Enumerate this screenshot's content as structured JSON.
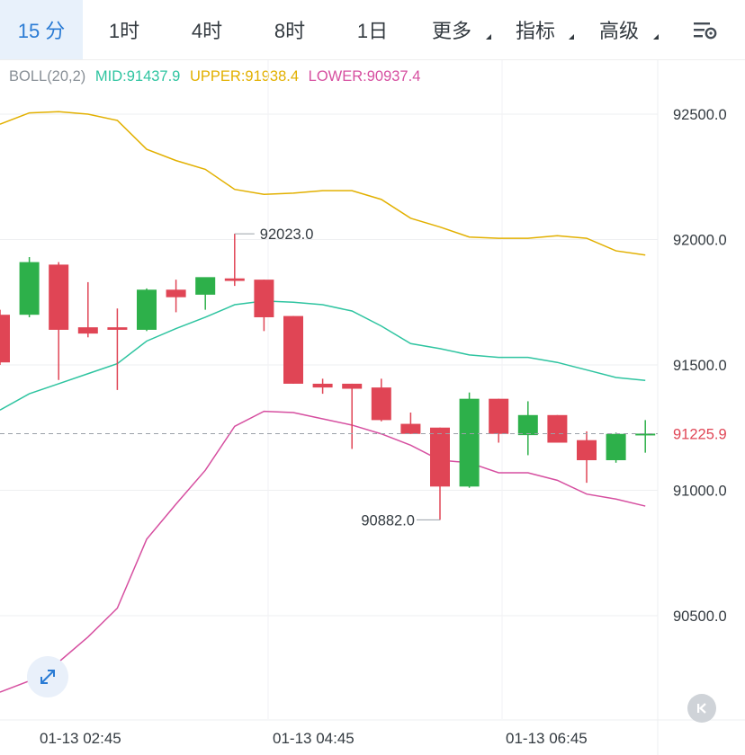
{
  "tabs": [
    {
      "label": "15 分",
      "active": true
    },
    {
      "label": "1时"
    },
    {
      "label": "4时"
    },
    {
      "label": "8时"
    },
    {
      "label": "1日"
    },
    {
      "label": "更多",
      "menu": true
    },
    {
      "label": "指标",
      "menu": true
    },
    {
      "label": "高级",
      "menu": true
    }
  ],
  "settings_icon": "chart-settings-icon",
  "legend": {
    "name": "BOLL(20,2)",
    "mid": "MID:91437.9",
    "upper": "UPPER:91938.4",
    "lower": "LOWER:90937.4"
  },
  "colors": {
    "up": "#2db04a",
    "down": "#e04555",
    "mid": "#2ec4a0",
    "upper": "#e2b000",
    "lower": "#d64fa0",
    "tab_active": "#2a7bd4"
  },
  "chart_data": {
    "type": "candlestick",
    "indicator": "BOLL(20,2)",
    "y_ticks": [
      92500.0,
      92000.0,
      91500.0,
      91000.0,
      90500.0
    ],
    "y_tick_labels": [
      "92500.0",
      "92000.0",
      "91500.0",
      "91000.0",
      "90500.0"
    ],
    "x_labels": [
      "01-13 02:45",
      "01-13 04:45",
      "01-13 06:45"
    ],
    "last_price": 91225.9,
    "last_price_label": "91225.9",
    "max_label": "92023.0",
    "min_label": "90882.0",
    "candles": [
      {
        "o": 91700,
        "h": 91720,
        "l": 91500,
        "c": 91510
      },
      {
        "o": 91700,
        "h": 91930,
        "l": 91690,
        "c": 91910
      },
      {
        "o": 91900,
        "h": 91910,
        "l": 91440,
        "c": 91640
      },
      {
        "o": 91650,
        "h": 91830,
        "l": 91610,
        "c": 91625
      },
      {
        "o": 91650,
        "h": 91725,
        "l": 91400,
        "c": 91640
      },
      {
        "o": 91640,
        "h": 91805,
        "l": 91635,
        "c": 91800
      },
      {
        "o": 91800,
        "h": 91840,
        "l": 91710,
        "c": 91770
      },
      {
        "o": 91780,
        "h": 91840,
        "l": 91720,
        "c": 91850
      },
      {
        "o": 91845,
        "h": 92023,
        "l": 91815,
        "c": 91835
      },
      {
        "o": 91840,
        "h": 91840,
        "l": 91635,
        "c": 91690
      },
      {
        "o": 91695,
        "h": 91695,
        "l": 91425,
        "c": 91425
      },
      {
        "o": 91425,
        "h": 91445,
        "l": 91385,
        "c": 91410
      },
      {
        "o": 91425,
        "h": 91425,
        "l": 91165,
        "c": 91405
      },
      {
        "o": 91410,
        "h": 91445,
        "l": 91275,
        "c": 91280
      },
      {
        "o": 91265,
        "h": 91310,
        "l": 91225,
        "c": 91225
      },
      {
        "o": 91250,
        "h": 91250,
        "l": 90882,
        "c": 91015
      },
      {
        "o": 91015,
        "h": 91390,
        "l": 91010,
        "c": 91365
      },
      {
        "o": 91365,
        "h": 91365,
        "l": 91190,
        "c": 91225
      },
      {
        "o": 91220,
        "h": 91355,
        "l": 91140,
        "c": 91300
      },
      {
        "o": 91300,
        "h": 91300,
        "l": 91190,
        "c": 91190
      },
      {
        "o": 91200,
        "h": 91235,
        "l": 91030,
        "c": 91120
      },
      {
        "o": 91120,
        "h": 91230,
        "l": 91110,
        "c": 91225
      },
      {
        "o": 91225,
        "h": 91280,
        "l": 91150,
        "c": 91226
      }
    ],
    "upper_line": [
      92460,
      92505,
      92510,
      92500,
      92475,
      92360,
      92315,
      92280,
      92200,
      92180,
      92185,
      92195,
      92195,
      92160,
      92085,
      92050,
      92010,
      92005,
      92005,
      92015,
      92005,
      91955,
      91938
    ],
    "mid_line": [
      91320,
      91385,
      91425,
      91465,
      91505,
      91595,
      91645,
      91690,
      91740,
      91755,
      91750,
      91740,
      91715,
      91655,
      91585,
      91565,
      91540,
      91530,
      91530,
      91510,
      91480,
      91450,
      91438
    ],
    "lower_line": [
      90195,
      90240,
      90315,
      90415,
      90530,
      90805,
      90945,
      91080,
      91255,
      91315,
      91310,
      91285,
      91260,
      91225,
      91180,
      91120,
      91110,
      91070,
      91070,
      91040,
      90985,
      90965,
      90937
    ]
  }
}
